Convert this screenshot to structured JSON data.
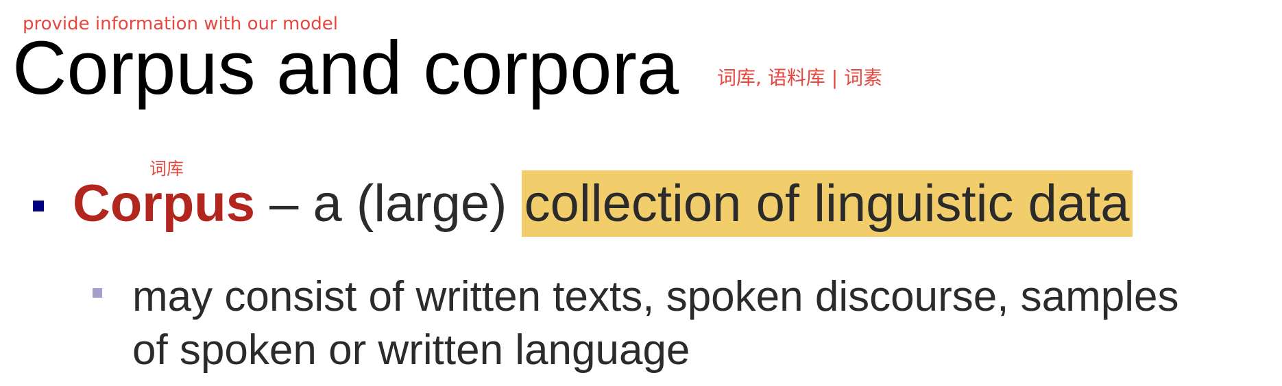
{
  "annotations": {
    "top_note": "provide information with our model",
    "title_note": "词库, 语料库 | 词素",
    "corpus_note": "词库"
  },
  "title": "Corpus and corpora",
  "bullets": [
    {
      "term": "Corpus",
      "separator": " – a (large) ",
      "highlighted": "collection of linguistic data",
      "highlight_color": "#f2cd6b",
      "term_color": "#b3261e",
      "marker_color": "#000080"
    }
  ],
  "sub_bullets": [
    {
      "line1": "may consist of written texts, spoken discourse, samples",
      "line2": "of spoken or written language",
      "marker_color": "#a3a0cc"
    }
  ],
  "colors": {
    "annotation": "#e8473f",
    "text": "#2b2b2b"
  }
}
